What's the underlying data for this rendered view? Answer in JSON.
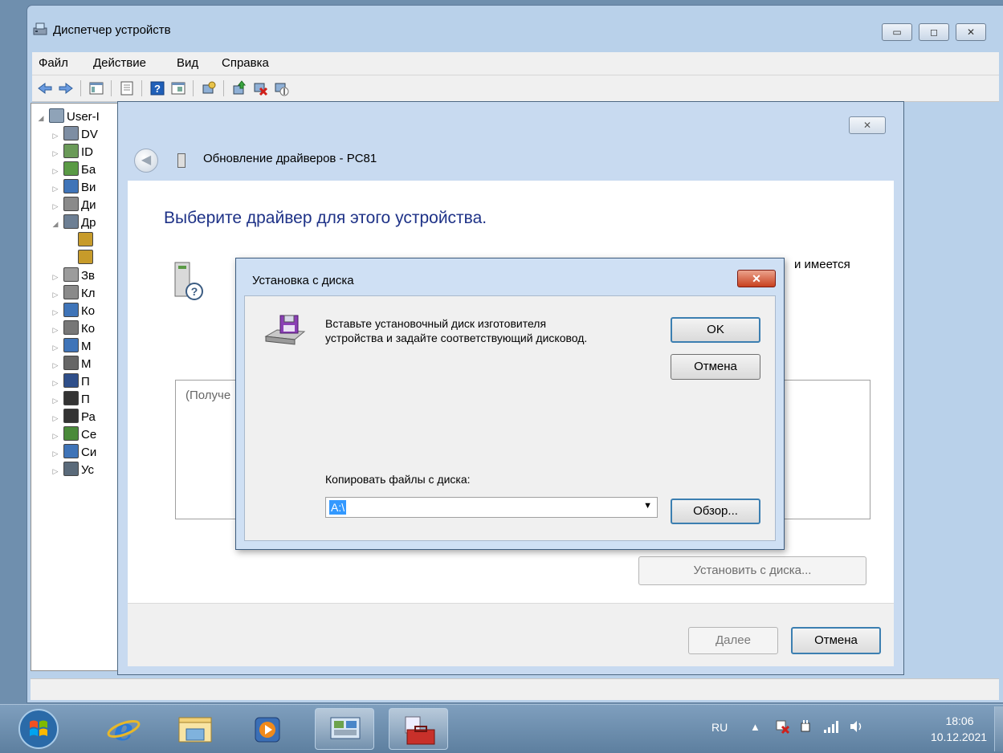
{
  "device_manager": {
    "title": "Диспетчер устройств",
    "caption_buttons": {
      "minimize": "▭",
      "maximize": "◻",
      "close": "✕"
    },
    "menu": [
      "Файл",
      "Действие",
      "Вид",
      "Справка"
    ],
    "toolbar_icons": [
      "back-arrow-icon",
      "forward-arrow-icon",
      "console-tree-icon",
      "properties-icon",
      "help-icon",
      "view-icon",
      "scan-hardware-icon",
      "update-driver-icon",
      "uninstall-icon",
      "disable-icon"
    ],
    "tree": {
      "root": "User-I",
      "items": [
        {
          "label": "DV",
          "expanded": false
        },
        {
          "label": "ID",
          "expanded": false
        },
        {
          "label": "Ба",
          "expanded": false
        },
        {
          "label": "Ви",
          "expanded": false
        },
        {
          "label": "Ди",
          "expanded": false
        },
        {
          "label": "Др",
          "expanded": true
        },
        {
          "label": "",
          "expanded": false
        },
        {
          "label": "",
          "expanded": false
        },
        {
          "label": "Зв",
          "expanded": false
        },
        {
          "label": "Кл",
          "expanded": false
        },
        {
          "label": "Ко",
          "expanded": false
        },
        {
          "label": "Ко",
          "expanded": false
        },
        {
          "label": "М",
          "expanded": false
        },
        {
          "label": "М",
          "expanded": false
        },
        {
          "label": "П",
          "expanded": false
        },
        {
          "label": "П",
          "expanded": false
        },
        {
          "label": "Ра",
          "expanded": false
        },
        {
          "label": "Се",
          "expanded": false
        },
        {
          "label": "Си",
          "expanded": false
        },
        {
          "label": "Ус",
          "expanded": false
        }
      ]
    }
  },
  "update_driver": {
    "header_title": "Обновление драйверов - PC81",
    "heading": "Выберите драйвер для этого устройства.",
    "partial_text": "и имеется",
    "list_partial": "(Получе",
    "have_disk_button": "Установить с диска...",
    "next_button": "Далее",
    "cancel_button": "Отмена",
    "close_glyph": "✕"
  },
  "install_from_disk": {
    "title": "Установка с диска",
    "message_line1": "Вставьте установочный диск изготовителя",
    "message_line2": "устройства и задайте соответствующий дисковод.",
    "ok_button": "OK",
    "cancel_button": "Отмена",
    "copy_label": "Копировать файлы с диска:",
    "copy_value": "A:\\",
    "browse_button": "Обзор...",
    "close_glyph": "✕"
  },
  "taskbar": {
    "language": "RU",
    "time": "18:06",
    "date": "10.12.2021",
    "tray_arrow": "▲"
  }
}
